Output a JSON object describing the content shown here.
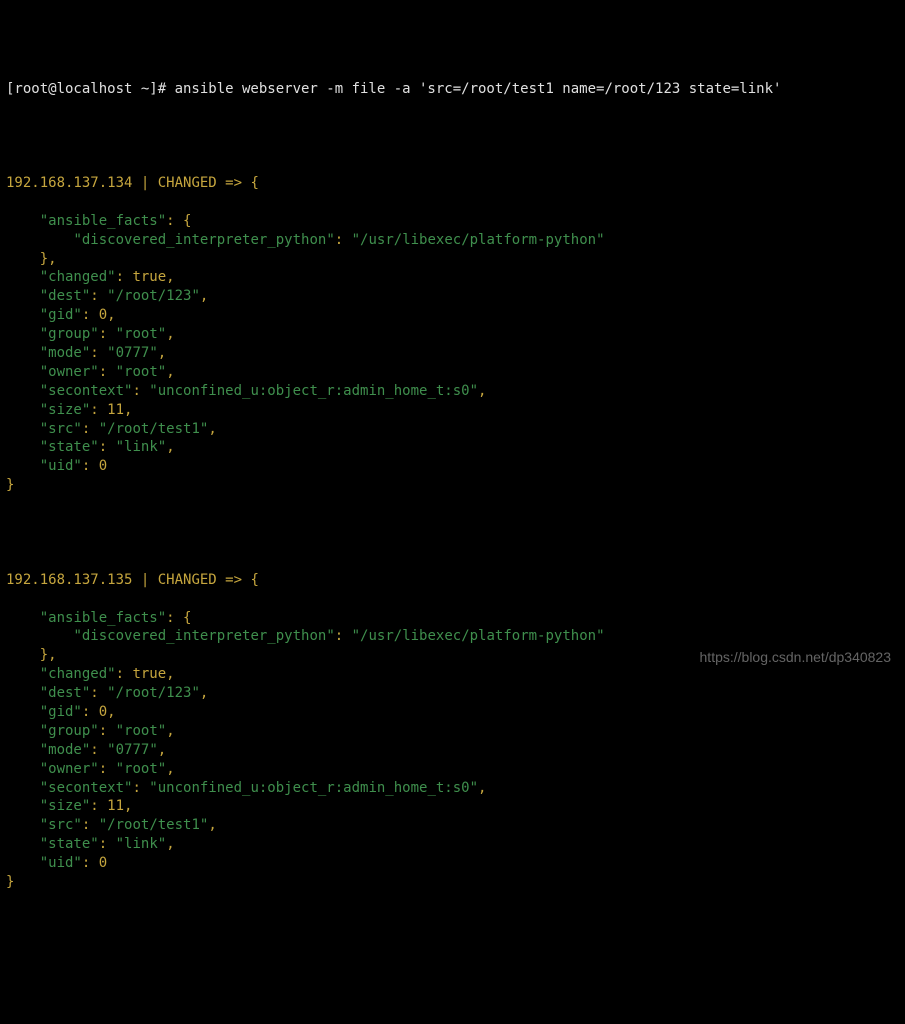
{
  "prompt": "[root@localhost ~]# ansible webserver -m file -a 'src=/root/test1 name=/root/123 state=link'",
  "hosts": [
    {
      "ip": "192.168.137.134",
      "status": "CHANGED",
      "facts_key": "ansible_facts",
      "interp_key": "discovered_interpreter_python",
      "interp_val": "/usr/libexec/platform-python",
      "fields": {
        "changed": "true",
        "dest": "/root/123",
        "gid": "0",
        "group": "root",
        "mode": "0777",
        "owner": "root",
        "secontext": "unconfined_u:object_r:admin_home_t:s0",
        "size": "11",
        "src": "/root/test1",
        "state": "link",
        "uid": "0"
      }
    },
    {
      "ip": "192.168.137.135",
      "status": "CHANGED",
      "facts_key": "ansible_facts",
      "interp_key": "discovered_interpreter_python",
      "interp_val": "/usr/libexec/platform-python",
      "fields": {
        "changed": "true",
        "dest": "/root/123",
        "gid": "0",
        "group": "root",
        "mode": "0777",
        "owner": "root",
        "secontext": "unconfined_u:object_r:admin_home_t:s0",
        "size": "11",
        "src": "/root/test1",
        "state": "link",
        "uid": "0"
      }
    }
  ],
  "watermark": "https://blog.csdn.net/dp340823"
}
